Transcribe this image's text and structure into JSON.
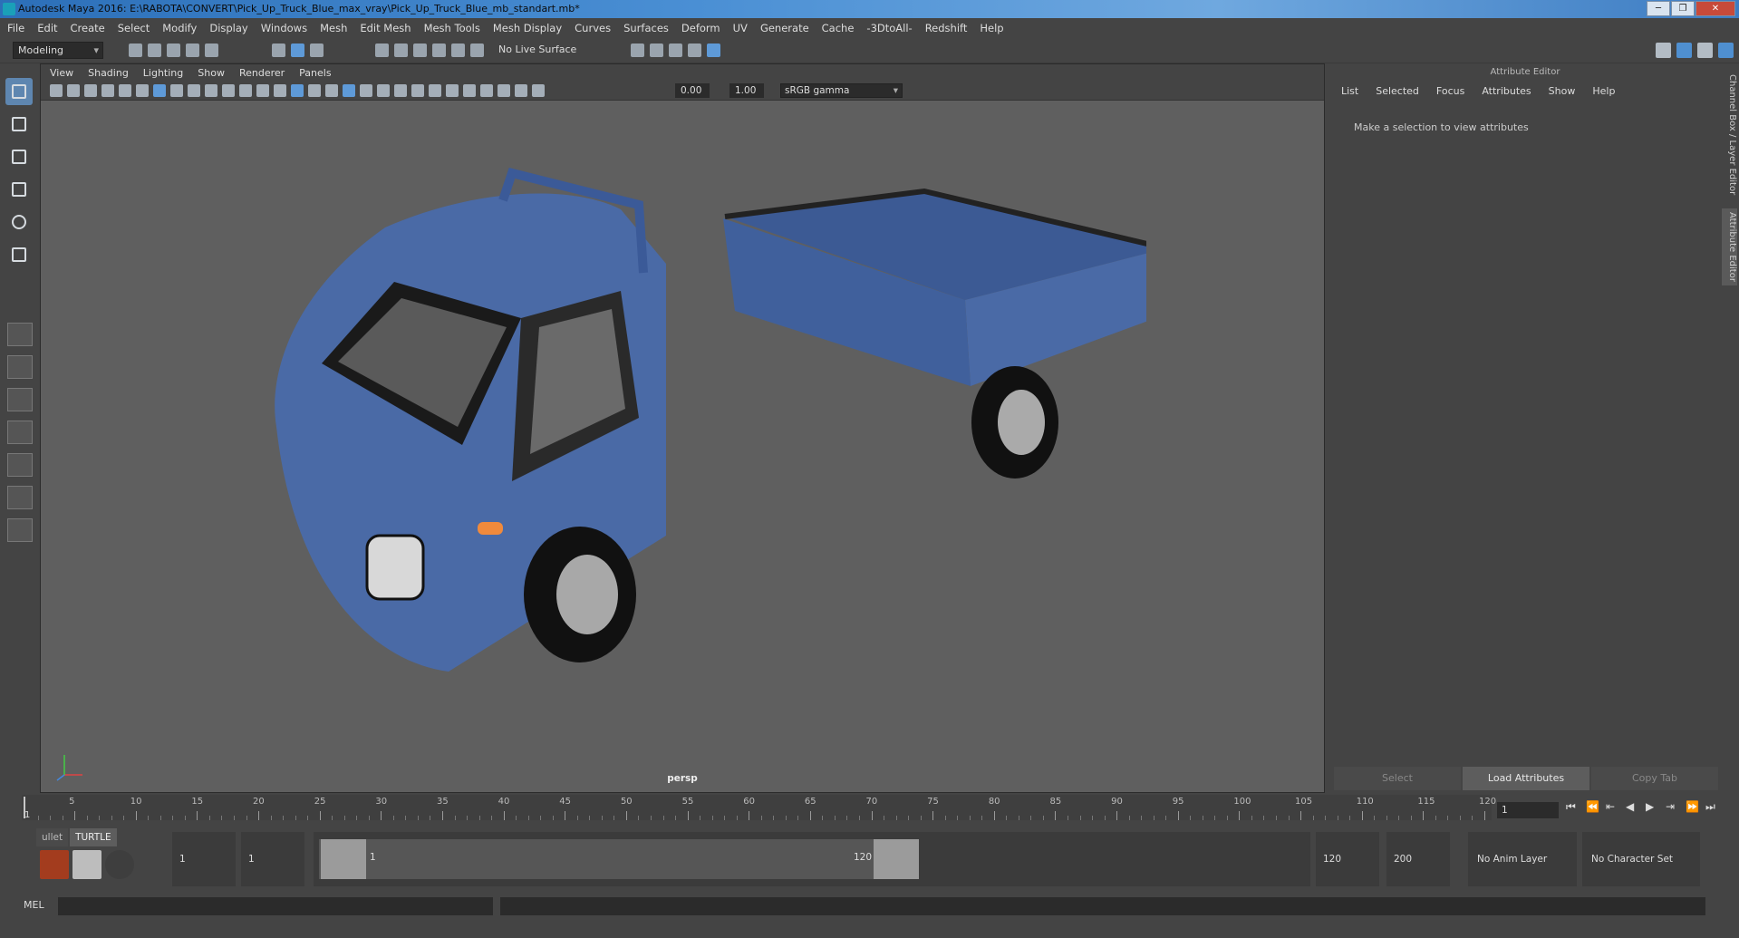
{
  "window": {
    "title": "Autodesk Maya 2016: E:\\RABOTA\\CONVERT\\Pick_Up_Truck_Blue_max_vray\\Pick_Up_Truck_Blue_mb_standart.mb*",
    "buttons": [
      "minimize",
      "restore",
      "close"
    ]
  },
  "menubar": [
    "File",
    "Edit",
    "Create",
    "Select",
    "Modify",
    "Display",
    "Windows",
    "Mesh",
    "Edit Mesh",
    "Mesh Tools",
    "Mesh Display",
    "Curves",
    "Surfaces",
    "Deform",
    "UV",
    "Generate",
    "Cache",
    "-3DtoAll-",
    "Redshift",
    "Help"
  ],
  "status_line": {
    "mode": "Modeling",
    "live_surface": "No Live Surface"
  },
  "viewport": {
    "menus": [
      "View",
      "Shading",
      "Lighting",
      "Show",
      "Renderer",
      "Panels"
    ],
    "exposure": "0.00",
    "gamma": "1.00",
    "color_space": "sRGB gamma",
    "camera": "persp"
  },
  "attribute_editor": {
    "title": "Attribute Editor",
    "menus": [
      "List",
      "Selected",
      "Focus",
      "Attributes",
      "Show",
      "Help"
    ],
    "message": "Make a selection to view attributes",
    "buttons": [
      "Select",
      "Load Attributes",
      "Copy Tab"
    ],
    "side_tabs": [
      "Channel Box / Layer Editor",
      "Attribute Editor"
    ]
  },
  "timeline": {
    "ticks": [
      "5",
      "10",
      "15",
      "20",
      "25",
      "30",
      "35",
      "40",
      "45",
      "50",
      "55",
      "60",
      "65",
      "70",
      "75",
      "80",
      "85",
      "90",
      "95",
      "100",
      "105",
      "110",
      "115",
      "120"
    ],
    "current_frame_label": "1",
    "current_frame": "1"
  },
  "range": {
    "shelf_tabs": [
      "ullet",
      "TURTLE"
    ],
    "start": "1",
    "playback_start": "1",
    "range_start_label": "1",
    "range_end_label": "120",
    "playback_end": "120",
    "end": "200",
    "anim_layer": "No Anim Layer",
    "character_set": "No Character Set"
  },
  "command_line": {
    "language": "MEL"
  },
  "colors": {
    "accent": "#5e86b0",
    "truck_body": "#4a6aa6"
  }
}
